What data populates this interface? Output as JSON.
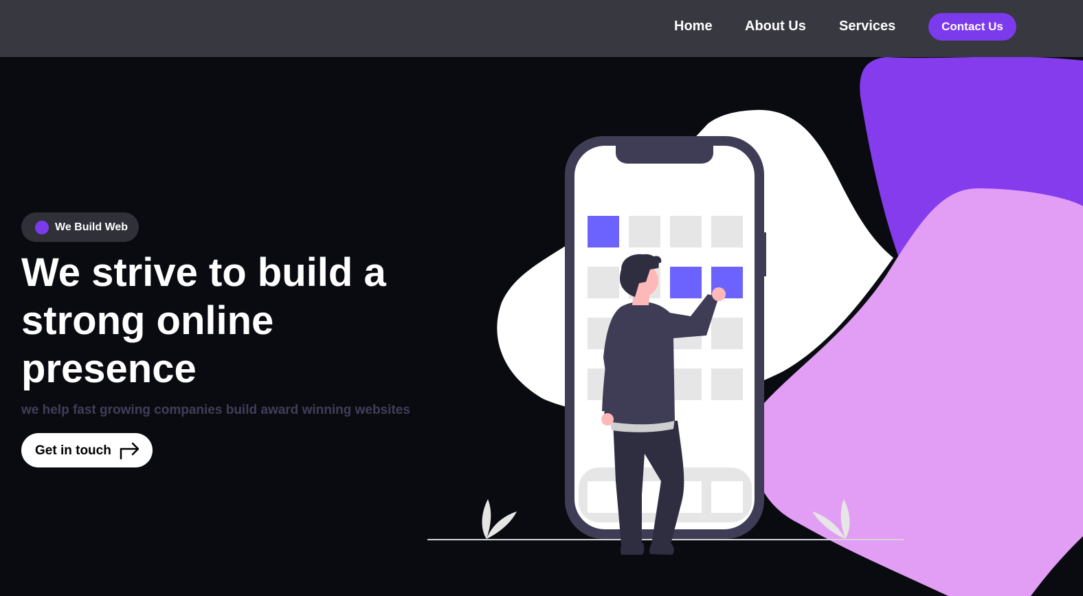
{
  "nav": {
    "home": "Home",
    "about": "About Us",
    "services": "Services",
    "contact": "Contact Us"
  },
  "hero": {
    "badge": "We Build Web",
    "headline_lines": [
      "We strive to build a",
      "strong online",
      "presence"
    ],
    "subtitle": "we help fast growing companies build award winning websites",
    "cta_label": "Get in touch"
  },
  "icons": {
    "cta_arrow": "arrow-turn-right-icon",
    "badge_dot": "dot-icon"
  },
  "colors": {
    "accent": "#7c3aed",
    "nav_bg": "#383841",
    "page_bg": "#0a0b10",
    "blob_purple": "#843ced",
    "blob_pink": "#e29ef5",
    "tile_highlight": "#6c63ff",
    "phone_frame": "#3f3d56"
  }
}
